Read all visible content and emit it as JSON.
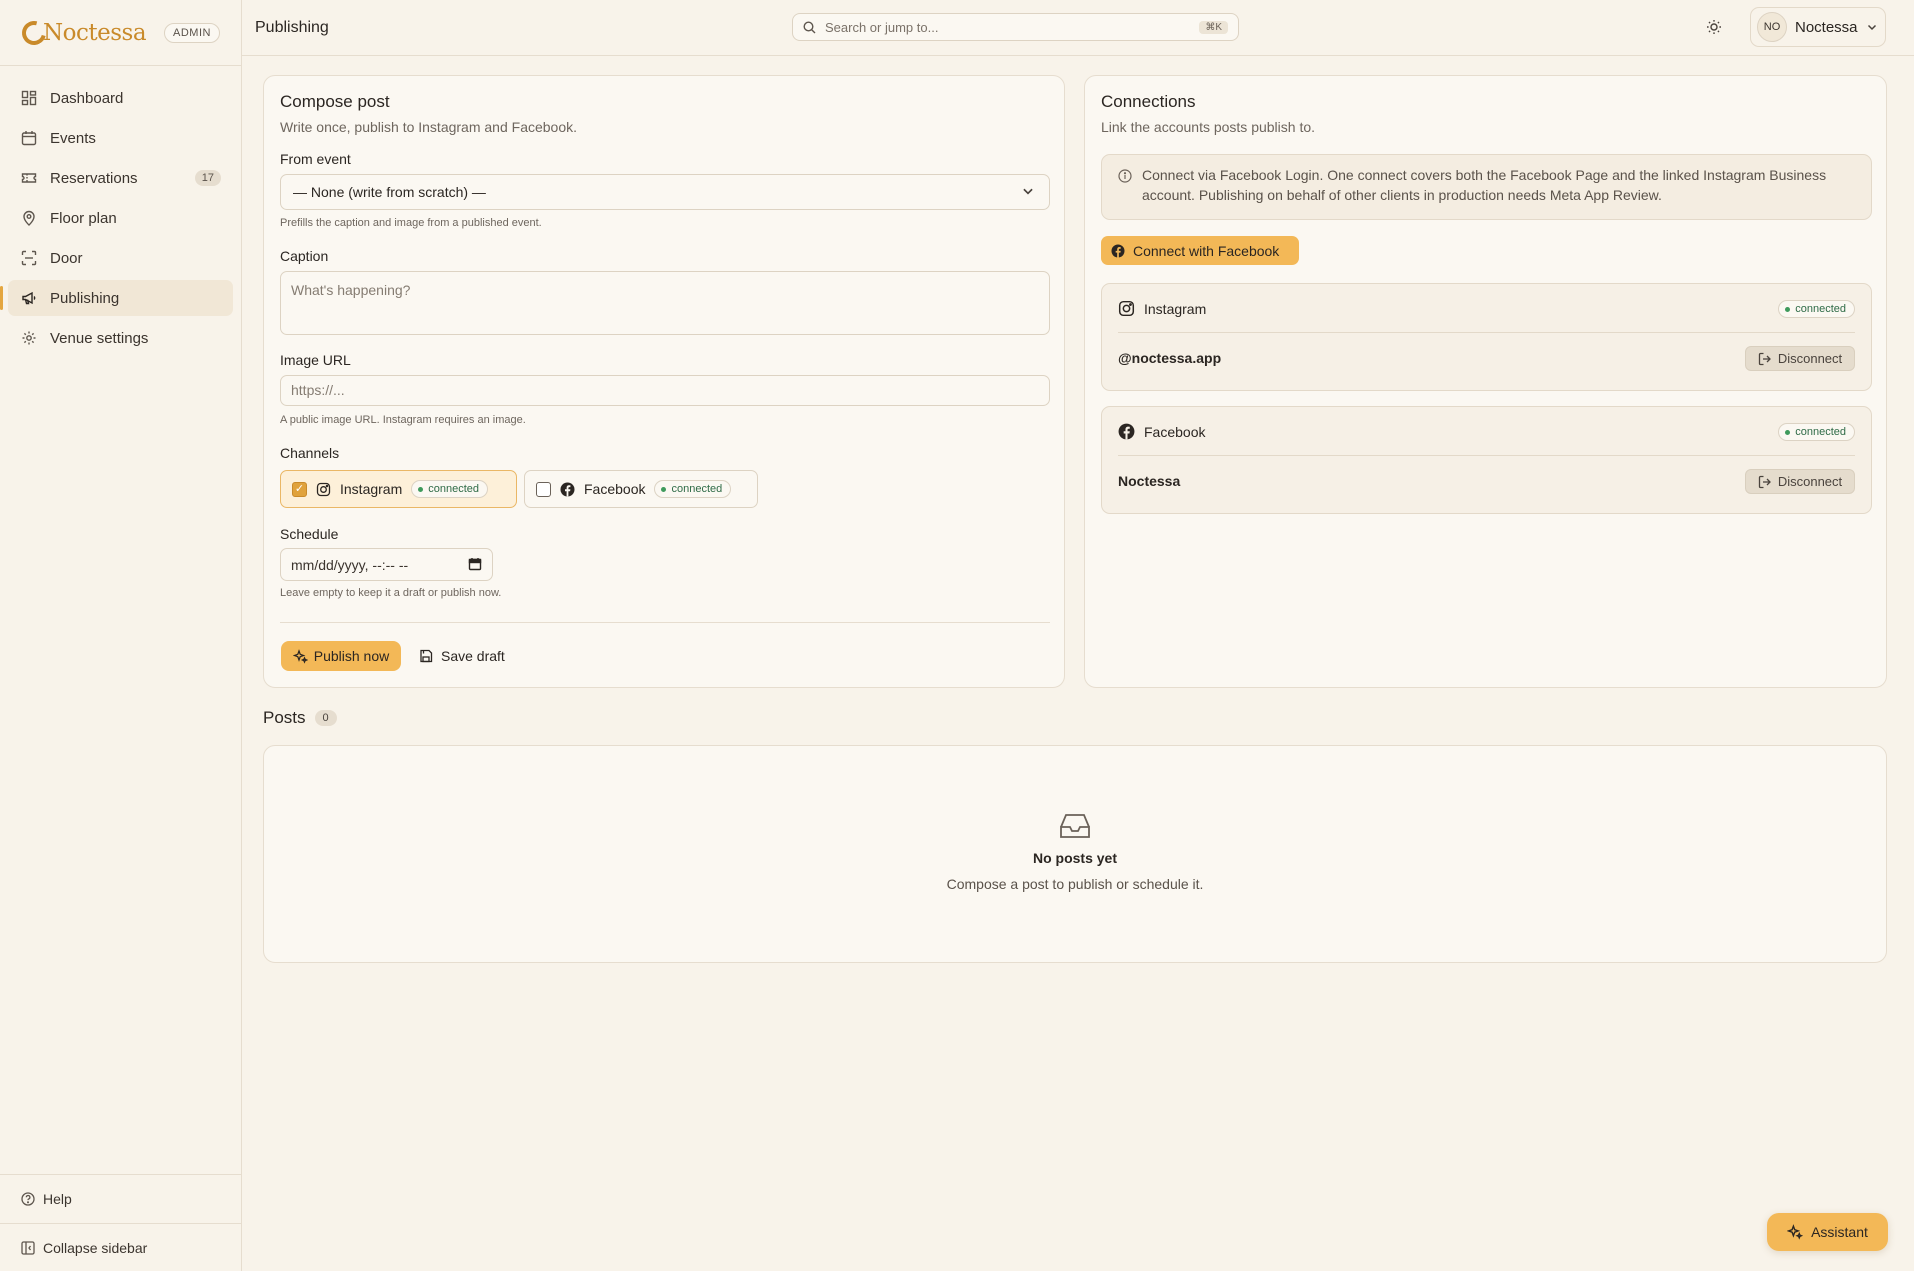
{
  "brand": {
    "name": "Noctessa",
    "role_badge": "ADMIN"
  },
  "sidebar": {
    "items": [
      {
        "label": "Dashboard",
        "icon": "dashboard-icon"
      },
      {
        "label": "Events",
        "icon": "calendar-icon"
      },
      {
        "label": "Reservations",
        "icon": "ticket-icon",
        "count": "17"
      },
      {
        "label": "Floor plan",
        "icon": "map-pin-icon"
      },
      {
        "label": "Door",
        "icon": "scan-icon"
      },
      {
        "label": "Publishing",
        "icon": "megaphone-icon",
        "active": true
      },
      {
        "label": "Venue settings",
        "icon": "gear-icon"
      }
    ],
    "help_label": "Help",
    "collapse_label": "Collapse sidebar"
  },
  "topbar": {
    "title": "Publishing",
    "search_placeholder": "Search or jump to...",
    "search_shortcut": "⌘K",
    "avatar_initials": "NO",
    "user_name": "Noctessa"
  },
  "compose": {
    "title": "Compose post",
    "subtitle": "Write once, publish to Instagram and Facebook.",
    "from_event_label": "From event",
    "from_event_value": "— None (write from scratch) —",
    "from_event_hint": "Prefills the caption and image from a published event.",
    "caption_label": "Caption",
    "caption_placeholder": "What's happening?",
    "image_label": "Image URL",
    "image_placeholder": "https://...",
    "image_hint": "A public image URL. Instagram requires an image.",
    "channels_label": "Channels",
    "channels": [
      {
        "name": "Instagram",
        "status": "connected",
        "checked": true
      },
      {
        "name": "Facebook",
        "status": "connected",
        "checked": false
      }
    ],
    "schedule_label": "Schedule",
    "schedule_placeholder": "mm/dd/yyyy, --:-- --",
    "schedule_hint": "Leave empty to keep it a draft or publish now.",
    "publish_label": "Publish now",
    "draft_label": "Save draft"
  },
  "connections": {
    "title": "Connections",
    "subtitle": "Link the accounts posts publish to.",
    "notice": "Connect via Facebook Login. One connect covers both the Facebook Page and the linked Instagram Business account. Publishing on behalf of other clients in production needs Meta App Review.",
    "connect_label": "Connect with Facebook",
    "accounts": [
      {
        "platform": "Instagram",
        "status": "connected",
        "handle": "@noctessa.app",
        "action": "Disconnect"
      },
      {
        "platform": "Facebook",
        "status": "connected",
        "handle": "Noctessa",
        "action": "Disconnect"
      }
    ]
  },
  "posts": {
    "title": "Posts",
    "count": "0",
    "empty_title": "No posts yet",
    "empty_sub": "Compose a post to publish or schedule it."
  },
  "assistant_label": "Assistant",
  "colors": {
    "accent": "#f3b857",
    "brand": "#c98a2a",
    "background": "#f8f3ea",
    "success": "#3e9a5c"
  }
}
